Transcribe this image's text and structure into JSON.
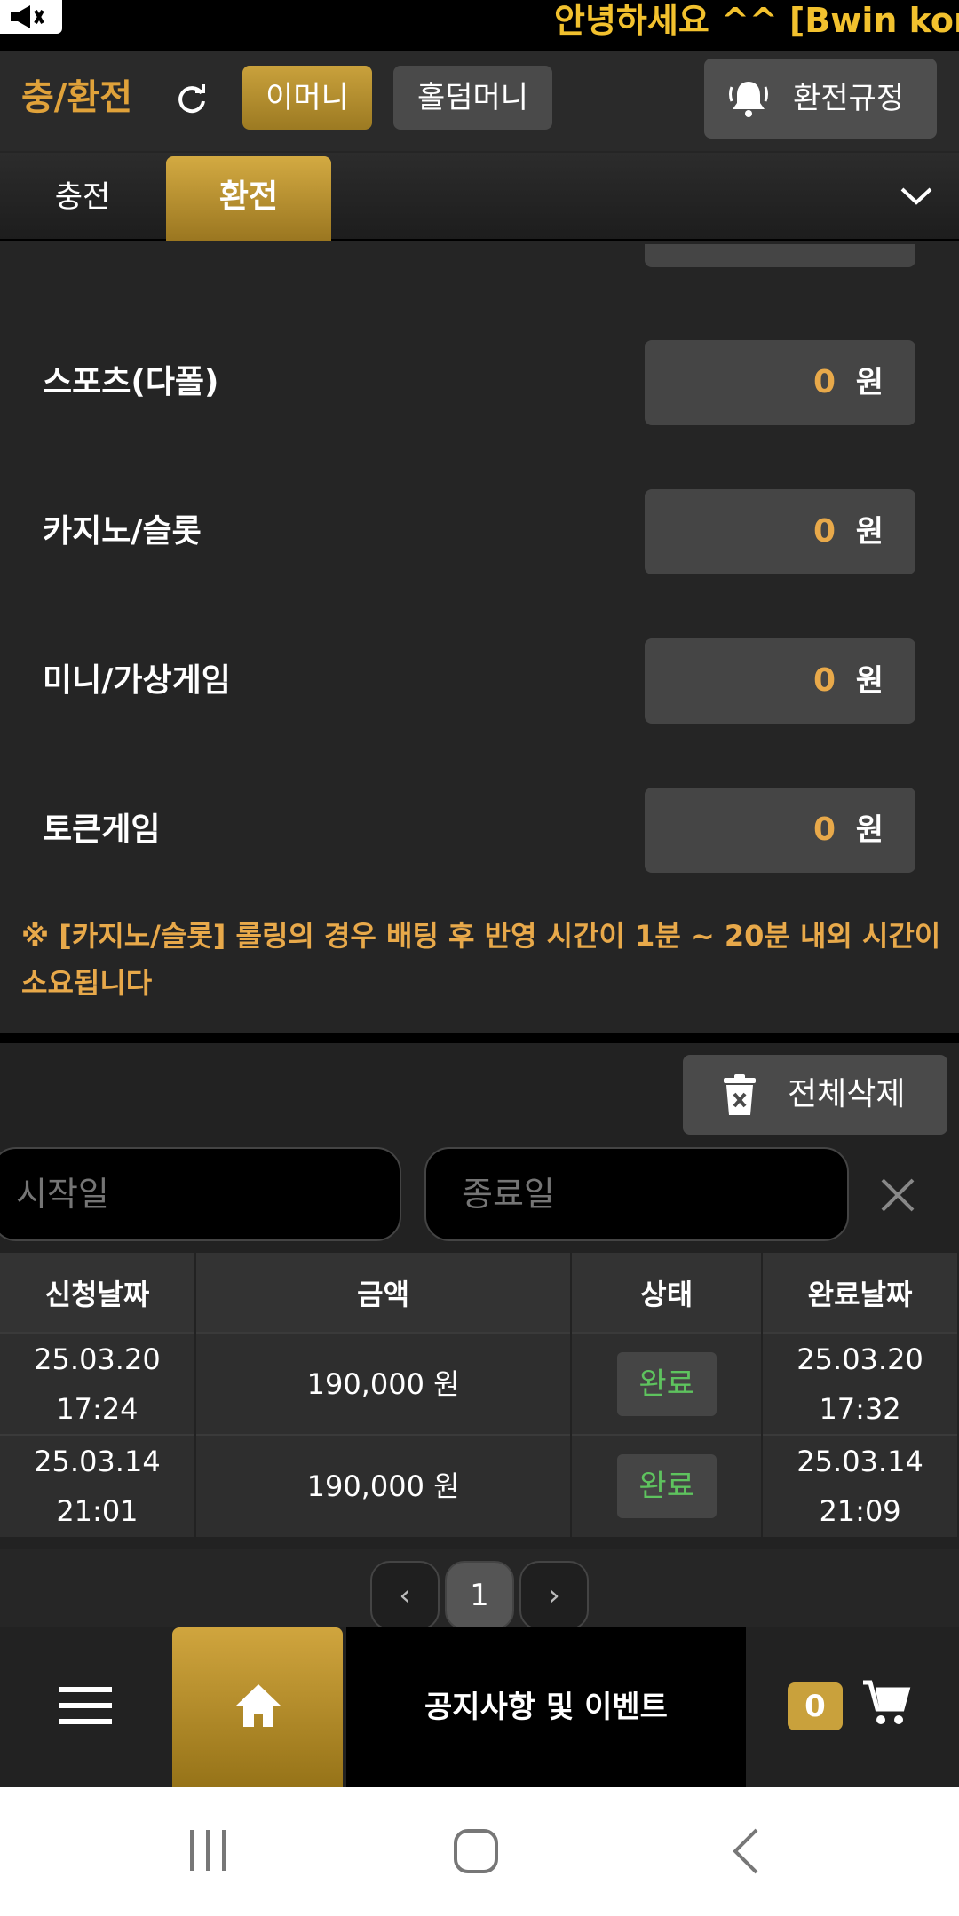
{
  "marquee": {
    "text": "안녕하세요 ^^ [Bwin korea"
  },
  "header": {
    "title": "충/환전",
    "emoney_label": "이머니",
    "holdem_label": "홀덤머니",
    "rules_label": "환전규정"
  },
  "tabs": {
    "charge": "충전",
    "exchange": "환전"
  },
  "rolling": {
    "rows": [
      {
        "label": "스포츠(다폴)",
        "value": "0",
        "unit": "원"
      },
      {
        "label": "카지노/슬롯",
        "value": "0",
        "unit": "원"
      },
      {
        "label": "미니/가상게임",
        "value": "0",
        "unit": "원"
      },
      {
        "label": "토큰게임",
        "value": "0",
        "unit": "원"
      }
    ],
    "notice": "※ [카지노/슬롯] 롤링의 경우 배팅 후 반영 시간이 1분 ~ 20분 내외 시간이 소요됩니다"
  },
  "history": {
    "delete_all_label": "전체삭제",
    "start_placeholder": "시작일",
    "end_placeholder": "종료일",
    "columns": [
      "신청날짜",
      "금액",
      "상태",
      "완료날짜"
    ],
    "rows": [
      {
        "request_date": "25.03.20",
        "request_time": "17:24",
        "amount": "190,000 원",
        "status": "완료",
        "complete_date": "25.03.20",
        "complete_time": "17:32"
      },
      {
        "request_date": "25.03.14",
        "request_time": "21:01",
        "amount": "190,000 원",
        "status": "완료",
        "complete_date": "25.03.14",
        "complete_time": "21:09"
      }
    ],
    "pagination": {
      "prev": "‹",
      "current": "1",
      "next": "›"
    }
  },
  "bottomnav": {
    "events_label": "공지사항 및 이벤트",
    "cart_count": "0"
  },
  "colors": {
    "accent_gold": "#c9a13c",
    "value_orange": "#e8a94a",
    "status_green": "#5ec35e"
  }
}
